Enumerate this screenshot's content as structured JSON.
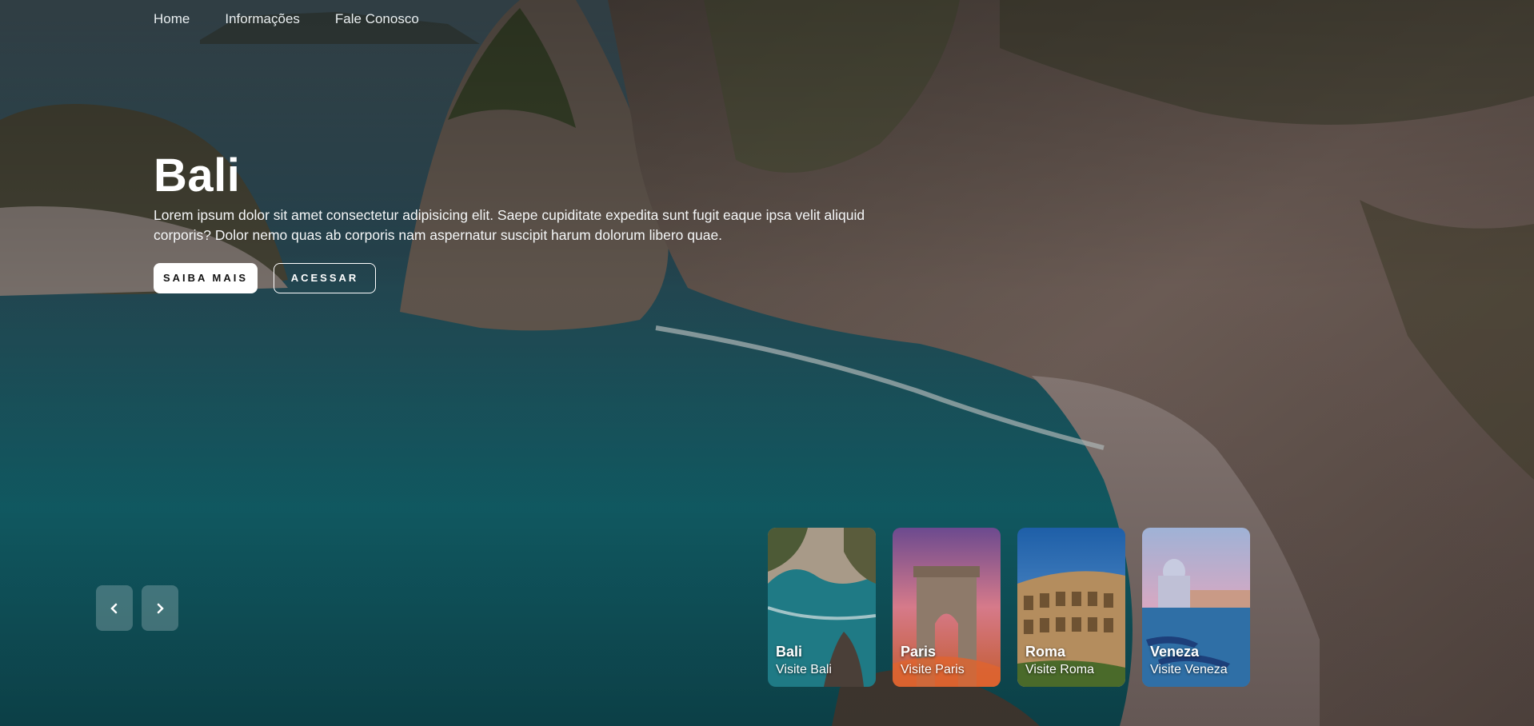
{
  "nav": {
    "items": [
      {
        "label": "Home"
      },
      {
        "label": "Informações"
      },
      {
        "label": "Fale Conosco"
      }
    ]
  },
  "hero": {
    "title": "Bali",
    "description": "Lorem ipsum dolor sit amet consectetur adipisicing elit. Saepe cupiditate expedita sunt fugit eaque ipsa velit aliquid corporis? Dolor nemo quas ab corporis nam aspernatur suscipit harum dolorum libero quae.",
    "primary_button": "SAIBA MAIS",
    "secondary_button": "ACESSAR"
  },
  "slider": {
    "prev_icon": "chevron-left-icon",
    "next_icon": "chevron-right-icon"
  },
  "cards": [
    {
      "title": "Bali",
      "subtitle": "Visite Bali"
    },
    {
      "title": "Paris",
      "subtitle": "Visite Paris"
    },
    {
      "title": "Roma",
      "subtitle": "Visite Roma"
    },
    {
      "title": "Veneza",
      "subtitle": "Visite Veneza"
    }
  ],
  "colors": {
    "sea": "#1f6f78",
    "cliff": "#7a6a63",
    "overlay": "#000000"
  }
}
